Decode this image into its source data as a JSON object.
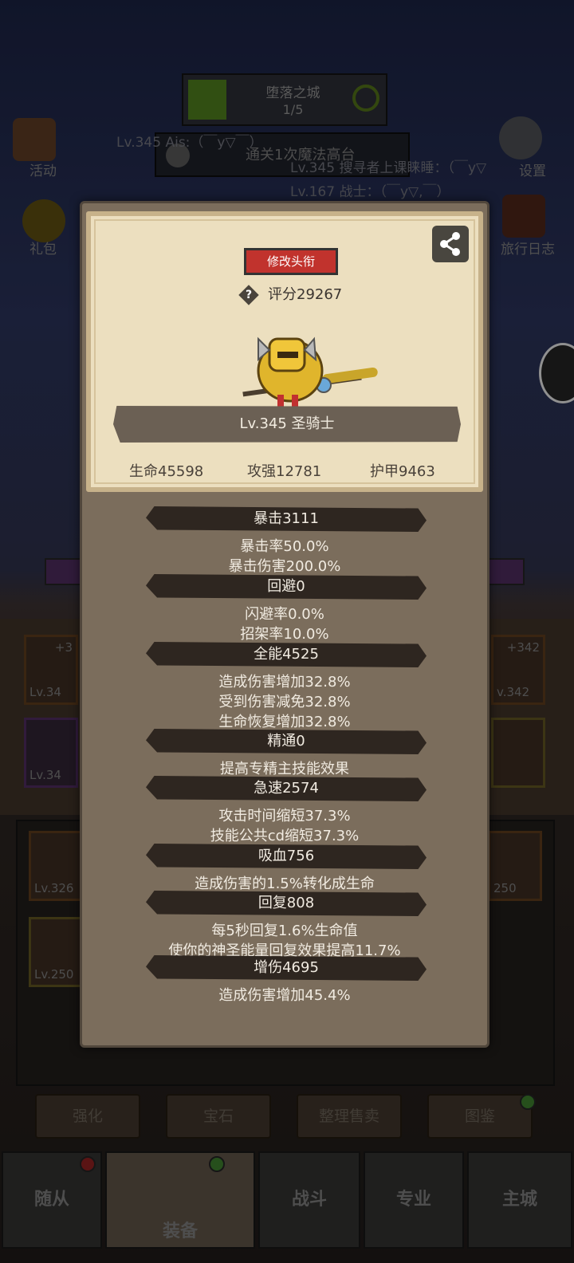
{
  "stage": {
    "name": "堕落之城",
    "progress": "1/5"
  },
  "quest": {
    "text": "通关1次魔法高台"
  },
  "chat": [
    "Lv.345 Ais:（￣y▽￣）",
    "Lv.345 搜寻者上课睐睡：（￣y▽",
    "Lv.167 战士：（￣y▽,￣）"
  ],
  "side_menu": {
    "activity": "活动",
    "gift": "礼包",
    "settings": "设置",
    "travel_log": "旅行日志"
  },
  "equip_slots": {
    "left_top_plus": "+3",
    "left_top_lv": "Lv.34",
    "left_mid_lv": "Lv.34",
    "right_top_plus": "+342",
    "right_top_lv": "v.342",
    "inv_a_lv": "Lv.326",
    "inv_b_lv": "Lv.250",
    "inv_c_lv": "250"
  },
  "actions": [
    "强化",
    "宝石",
    "整理售卖",
    "图鉴"
  ],
  "nav": [
    "随从",
    "装备",
    "战斗",
    "专业",
    "主城"
  ],
  "popup": {
    "change_title": "修改头衔",
    "score": "评分29267",
    "hero_name": "Lv.345 圣骑士",
    "hp": "生命45598",
    "attack": "攻强12781",
    "armor": "护甲9463",
    "stats": [
      {
        "head": "暴击3111",
        "lines": [
          "暴击率50.0%",
          "暴击伤害200.0%"
        ]
      },
      {
        "head": "回避0",
        "lines": [
          "闪避率0.0%",
          "招架率10.0%"
        ]
      },
      {
        "head": "全能4525",
        "lines": [
          "造成伤害增加32.8%",
          "受到伤害减免32.8%",
          "生命恢复增加32.8%"
        ]
      },
      {
        "head": "精通0",
        "lines": [
          "提高专精主技能效果"
        ]
      },
      {
        "head": "急速2574",
        "lines": [
          "攻击时间缩短37.3%",
          "技能公共cd缩短37.3%"
        ]
      },
      {
        "head": "吸血756",
        "lines": [
          "造成伤害的1.5%转化成生命"
        ]
      },
      {
        "head": "回复808",
        "lines": [
          "每5秒回复1.6%生命值",
          "使你的神圣能量回复效果提高11.7%"
        ]
      },
      {
        "head": "增伤4695",
        "lines": [
          "造成伤害增加45.4%"
        ]
      }
    ]
  },
  "colors": {
    "accent_red": "#c1332d",
    "panel": "#7b6d5c",
    "card": "#ecdfbf"
  }
}
